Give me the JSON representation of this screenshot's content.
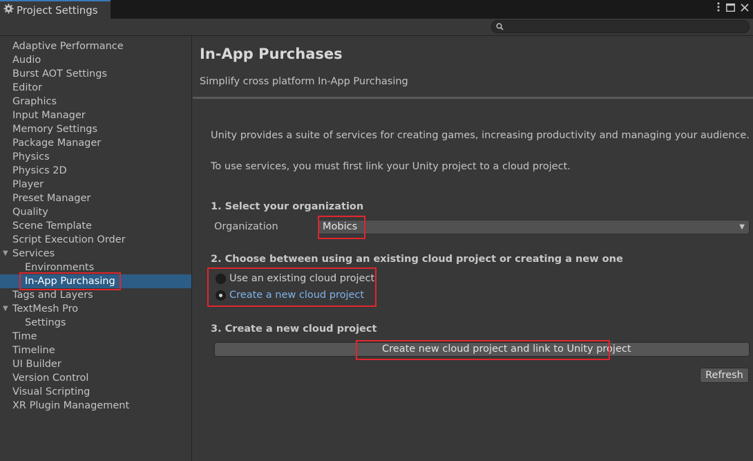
{
  "window": {
    "tab_title": "Project Settings",
    "tab_icon": "gear-icon",
    "controls": [
      "kebab-menu-icon",
      "maximize-icon",
      "close-icon"
    ]
  },
  "search": {
    "placeholder": "",
    "value": ""
  },
  "sidebar": {
    "items": [
      {
        "label": "Adaptive Performance",
        "level": 0
      },
      {
        "label": "Audio",
        "level": 0
      },
      {
        "label": "Burst AOT Settings",
        "level": 0
      },
      {
        "label": "Editor",
        "level": 0
      },
      {
        "label": "Graphics",
        "level": 0
      },
      {
        "label": "Input Manager",
        "level": 0
      },
      {
        "label": "Memory Settings",
        "level": 0
      },
      {
        "label": "Package Manager",
        "level": 0
      },
      {
        "label": "Physics",
        "level": 0
      },
      {
        "label": "Physics 2D",
        "level": 0
      },
      {
        "label": "Player",
        "level": 0
      },
      {
        "label": "Preset Manager",
        "level": 0
      },
      {
        "label": "Quality",
        "level": 0
      },
      {
        "label": "Scene Template",
        "level": 0
      },
      {
        "label": "Script Execution Order",
        "level": 0
      },
      {
        "label": "Services",
        "level": 0,
        "expanded": true
      },
      {
        "label": "Environments",
        "level": 1
      },
      {
        "label": "In-App Purchasing",
        "level": 1,
        "selected": true
      },
      {
        "label": "Tags and Layers",
        "level": 0
      },
      {
        "label": "TextMesh Pro",
        "level": 0,
        "expanded": true
      },
      {
        "label": "Settings",
        "level": 1
      },
      {
        "label": "Time",
        "level": 0
      },
      {
        "label": "Timeline",
        "level": 0
      },
      {
        "label": "UI Builder",
        "level": 0
      },
      {
        "label": "Version Control",
        "level": 0
      },
      {
        "label": "Visual Scripting",
        "level": 0
      },
      {
        "label": "XR Plugin Management",
        "level": 0
      }
    ]
  },
  "main": {
    "title": "In-App Purchases",
    "subtitle": "Simplify cross platform In-App Purchasing",
    "intro": "Unity provides a suite of services for creating games, increasing productivity and managing your audience.",
    "link_hint": "To use services, you must first link your Unity project to a cloud project.",
    "step1_heading": "1. Select your organization",
    "org_label": "Organization",
    "org_value": "Mobics",
    "step2_heading": "2. Choose between using an existing cloud project or creating a new one",
    "radio_existing": "Use an existing cloud project",
    "radio_new": "Create a new cloud project",
    "selected_option": "new",
    "step3_heading": "3. Create a new cloud project",
    "create_button": "Create new cloud project and link to Unity project",
    "refresh_button": "Refresh"
  },
  "colors": {
    "highlight_box": "#e3252d",
    "selection": "#2c5d87",
    "accent_link": "#7fb3ec"
  }
}
